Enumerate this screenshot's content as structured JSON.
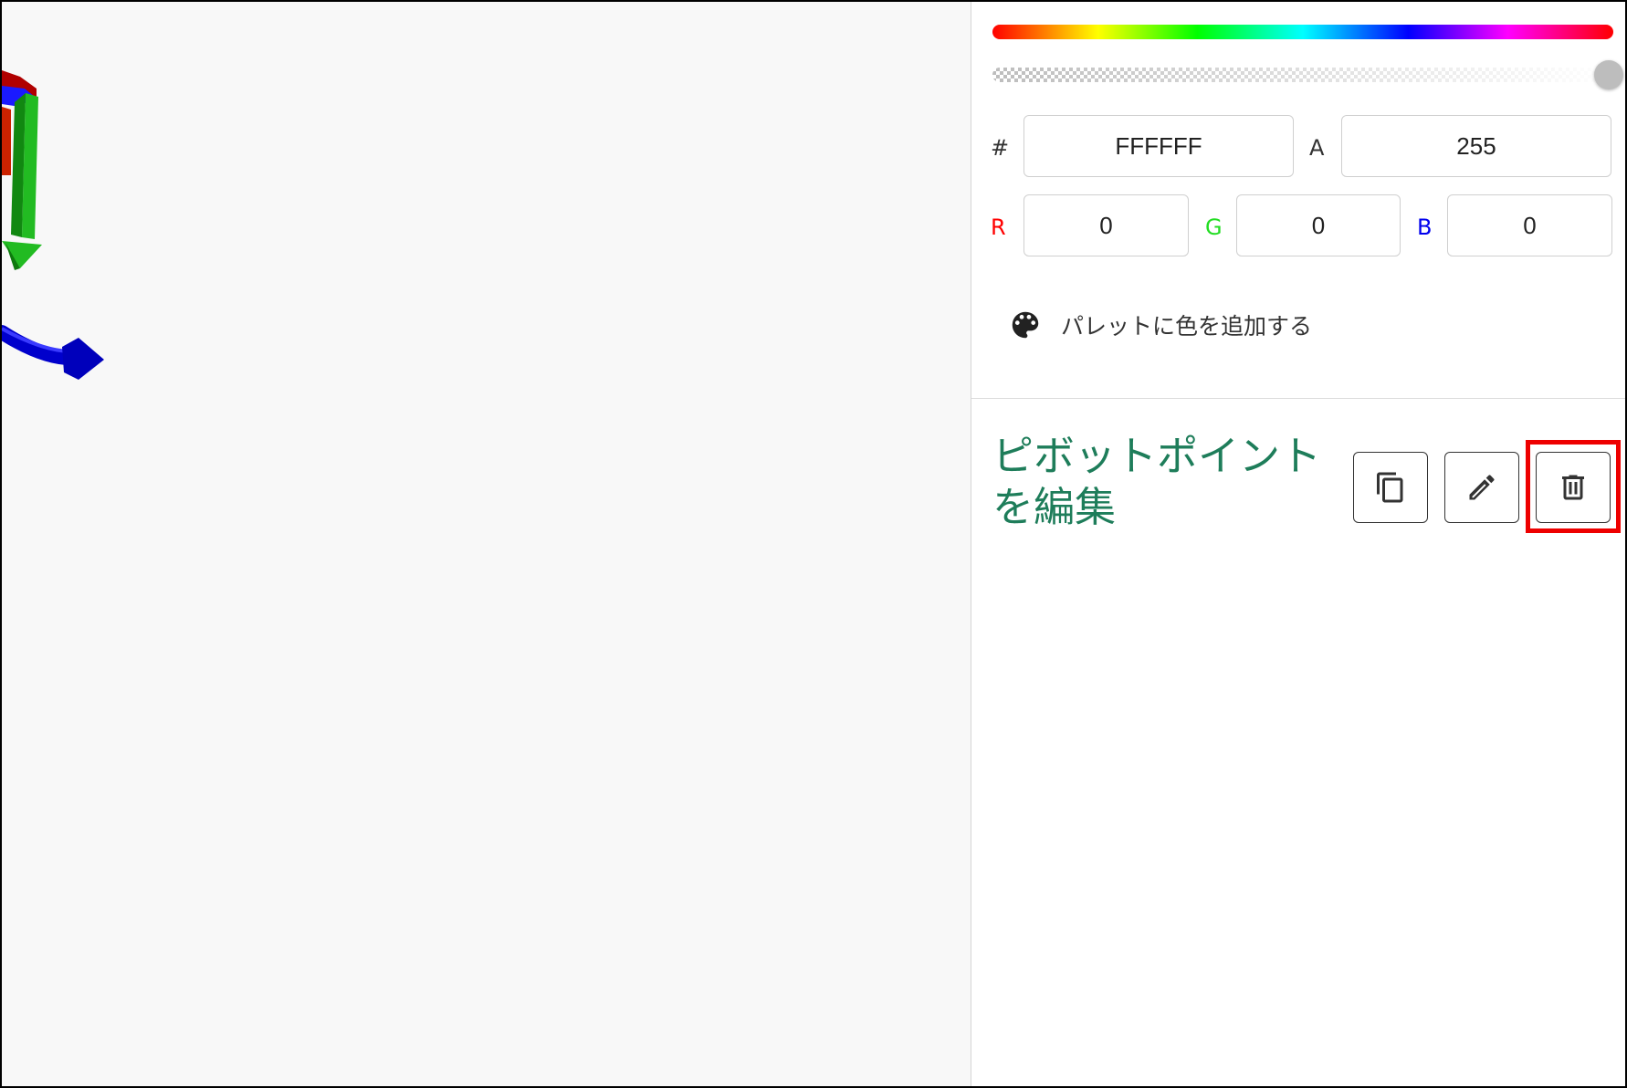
{
  "color_picker": {
    "hex_label": "#",
    "hex_value": "FFFFFF",
    "alpha_label": "A",
    "alpha_value": "255",
    "r_label": "R",
    "r_value": "0",
    "g_label": "G",
    "g_value": "0",
    "b_label": "B",
    "b_value": "0",
    "alpha_fraction": 1.0,
    "add_to_palette_label": "パレットに色を追加する"
  },
  "pivot_section": {
    "title": "ピボットポイント\nを編集"
  },
  "colors": {
    "title_green": "#1e7d5a",
    "r_color": "#ff0000",
    "g_color": "#22dd22",
    "b_color": "#0000ee",
    "highlight": "#ee0000",
    "gizmo_red": "#cc0000",
    "gizmo_green": "#22bb22",
    "gizmo_blue": "#0000cc"
  },
  "icons": {
    "palette": "palette-icon",
    "copy": "copy-icon",
    "edit": "pencil-icon",
    "delete": "trash-icon"
  }
}
